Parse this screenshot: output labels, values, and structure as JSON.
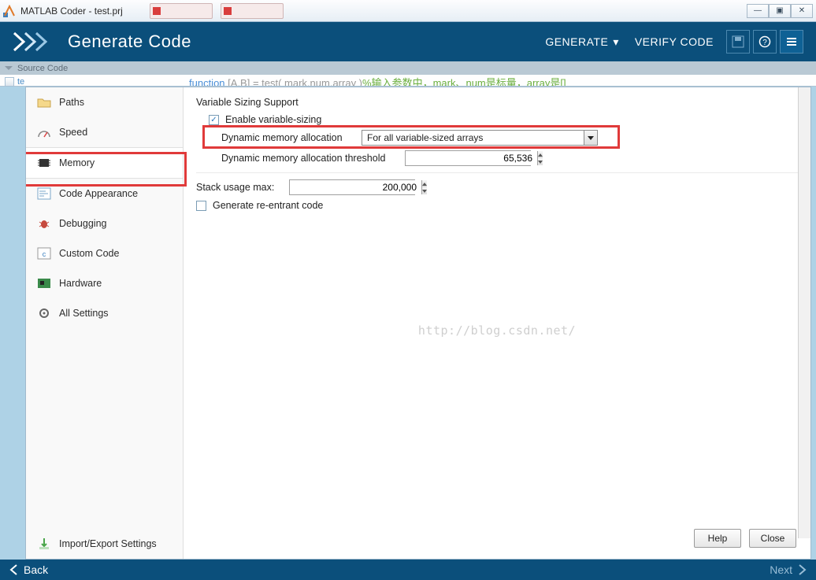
{
  "window": {
    "title": "MATLAB Coder - test.prj"
  },
  "toolbar": {
    "heading": "Generate Code",
    "generate": "GENERATE",
    "verify": "VERIFY CODE"
  },
  "source_strip": {
    "label": "Source Code"
  },
  "code_peek": {
    "kw": "function",
    "sig": " [A,B] = test( mark,num,array )",
    "comment": "%输入参数中，mark、num是标量，array是[]"
  },
  "sidebar_peek": {
    "label": "te"
  },
  "sidebar": {
    "items": [
      {
        "label": "Paths"
      },
      {
        "label": "Speed"
      },
      {
        "label": "Memory"
      },
      {
        "label": "Code Appearance"
      },
      {
        "label": "Debugging"
      },
      {
        "label": "Custom Code"
      },
      {
        "label": "Hardware"
      },
      {
        "label": "All Settings"
      }
    ],
    "bottom": {
      "label": "Import/Export Settings"
    }
  },
  "content": {
    "group_header": "Variable Sizing Support",
    "enable_label": "Enable variable-sizing",
    "enable_checked": "✓",
    "dyn_alloc_label": "Dynamic memory allocation",
    "dyn_alloc_value": "For all variable-sized arrays",
    "threshold_label": "Dynamic memory allocation threshold",
    "threshold_value": "65,536",
    "stack_label": "Stack usage max:",
    "stack_value": "200,000",
    "reentrant_label": "Generate re-entrant code"
  },
  "watermark": "http://blog.csdn.net/",
  "buttons": {
    "help": "Help",
    "close": "Close"
  },
  "footer": {
    "back": "Back",
    "next": "Next"
  }
}
